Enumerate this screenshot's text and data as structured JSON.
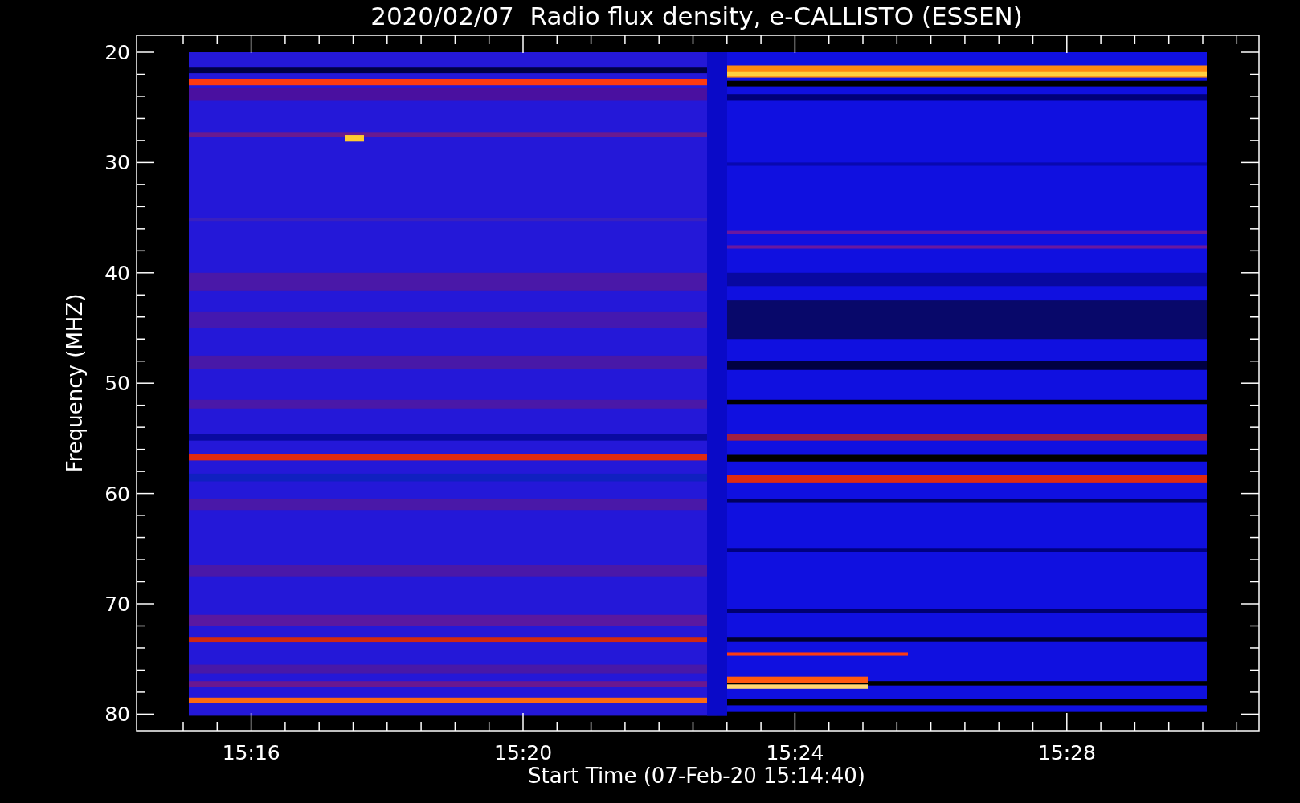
{
  "title": "2020/02/07  Radio flux density, e-CALLISTO (ESSEN)",
  "plot": {
    "ylabel": "Frequency (MHZ)",
    "xlabel": "Start Time (07-Feb-20 15:14:40)",
    "yticks": [
      "20",
      "30",
      "40",
      "50",
      "60",
      "70",
      "80"
    ],
    "xticks": [
      "15:16",
      "15:20",
      "15:24",
      "15:28"
    ]
  }
}
